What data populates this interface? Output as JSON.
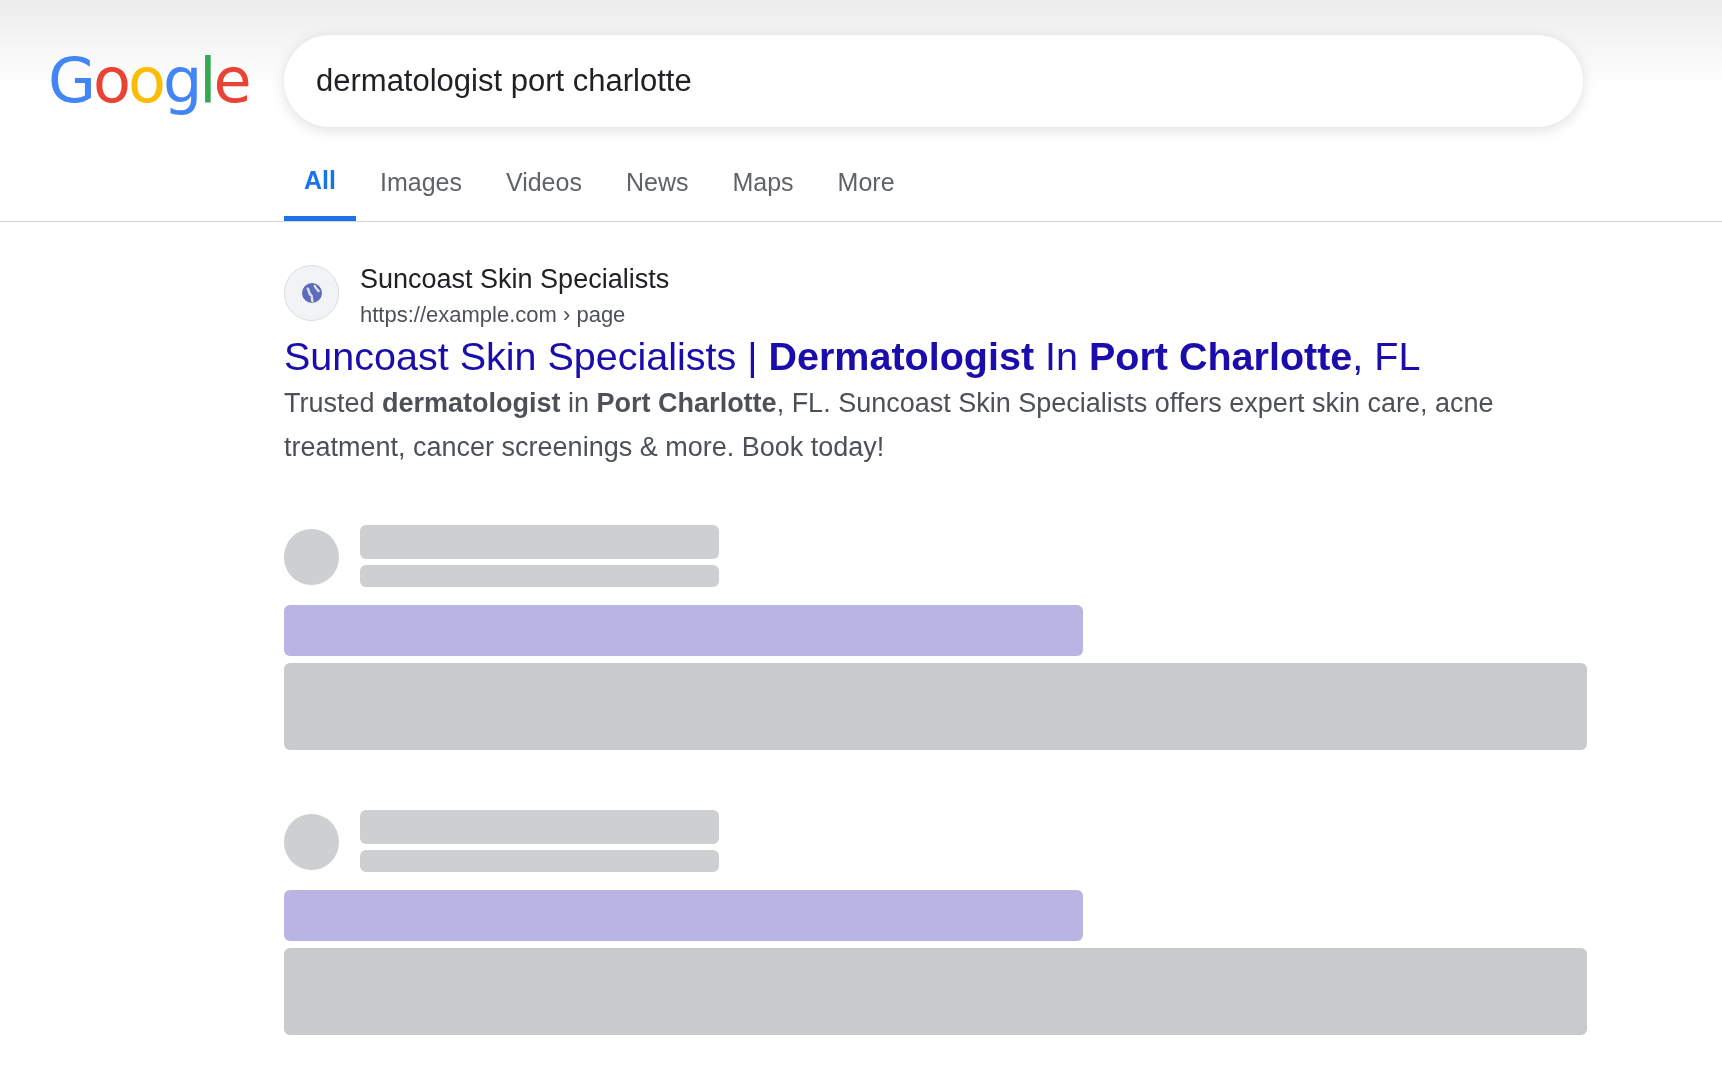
{
  "logo": {
    "text": "Google"
  },
  "search": {
    "value": "dermatologist port charlotte"
  },
  "tabs": [
    {
      "label": "All",
      "selected": true
    },
    {
      "label": "Images",
      "selected": false
    },
    {
      "label": "Videos",
      "selected": false
    },
    {
      "label": "News",
      "selected": false
    },
    {
      "label": "Maps",
      "selected": false
    },
    {
      "label": "More",
      "selected": false
    }
  ],
  "result": {
    "site_name": "Suncoast Skin Specialists",
    "url": "https://example.com › page",
    "title": "Suncoast Skin Specialists | **Dermatologist** In **Port Charlotte**, FL",
    "snippet": "Trusted **dermatologist** in **Port Charlotte**, FL. Suncoast Skin Specialists offers expert skin care, acne treatment, cancer screenings & more. Book today!"
  },
  "loading_results": [
    {
      "kind": "skeleton"
    },
    {
      "kind": "skeleton"
    }
  ]
}
